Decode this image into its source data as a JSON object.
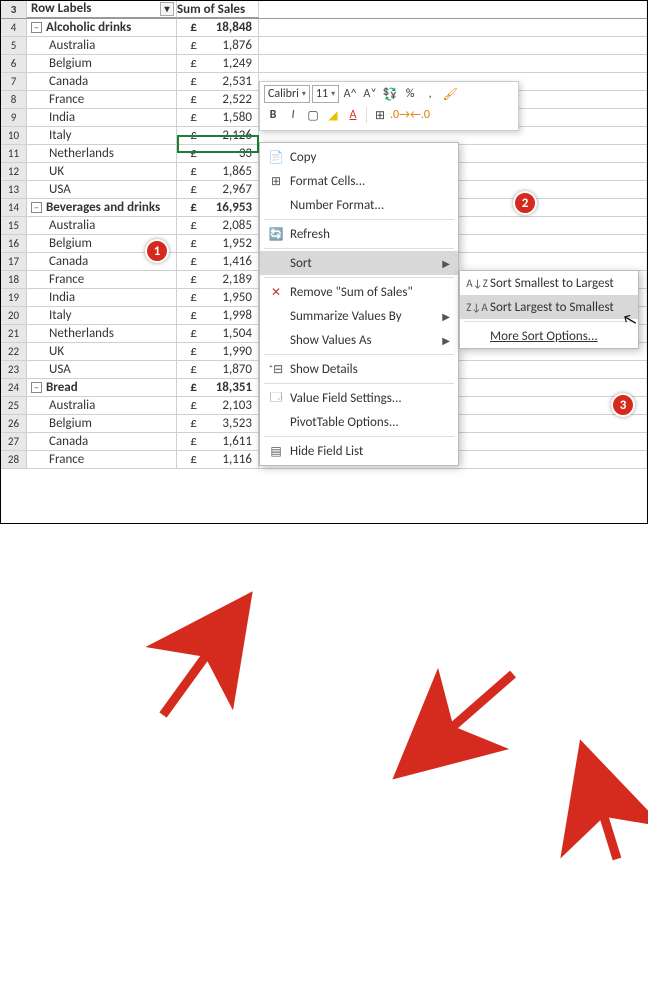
{
  "header": {
    "col_a": "Row Labels",
    "col_bc": "Sum of Sales"
  },
  "currency": "£",
  "rows": [
    {
      "n": 3,
      "type": "header"
    },
    {
      "n": 4,
      "type": "group",
      "label": "Alcoholic drinks",
      "value": "18,848"
    },
    {
      "n": 5,
      "type": "item",
      "label": "Australia",
      "value": "1,876"
    },
    {
      "n": 6,
      "type": "item",
      "label": "Belgium",
      "value": "1,249"
    },
    {
      "n": 7,
      "type": "item",
      "label": "Canada",
      "value": "2,531"
    },
    {
      "n": 8,
      "type": "item",
      "label": "France",
      "value": "2,522"
    },
    {
      "n": 9,
      "type": "item",
      "label": "India",
      "value": "1,580"
    },
    {
      "n": 10,
      "type": "item",
      "label": "Italy",
      "value": "2,126",
      "selected": true
    },
    {
      "n": 11,
      "type": "item",
      "label": "Netherlands",
      "value": "33",
      "obscured": true
    },
    {
      "n": 12,
      "type": "item",
      "label": "UK",
      "value": "1,865",
      "obscured": true
    },
    {
      "n": 13,
      "type": "item",
      "label": "USA",
      "value": "2,967"
    },
    {
      "n": 14,
      "type": "group",
      "label": "Beverages and drinks",
      "value": "16,953"
    },
    {
      "n": 15,
      "type": "item",
      "label": "Australia",
      "value": "2,085"
    },
    {
      "n": 16,
      "type": "item",
      "label": "Belgium",
      "value": "1,952"
    },
    {
      "n": 17,
      "type": "item",
      "label": "Canada",
      "value": "1,416"
    },
    {
      "n": 18,
      "type": "item",
      "label": "France",
      "value": "2,189"
    },
    {
      "n": 19,
      "type": "item",
      "label": "India",
      "value": "1,950"
    },
    {
      "n": 20,
      "type": "item",
      "label": "Italy",
      "value": "1,998"
    },
    {
      "n": 21,
      "type": "item",
      "label": "Netherlands",
      "value": "1,504"
    },
    {
      "n": 22,
      "type": "item",
      "label": "UK",
      "value": "1,990"
    },
    {
      "n": 23,
      "type": "item",
      "label": "USA",
      "value": "1,870"
    },
    {
      "n": 24,
      "type": "group",
      "label": "Bread",
      "value": "18,351"
    },
    {
      "n": 25,
      "type": "item",
      "label": "Australia",
      "value": "2,103"
    },
    {
      "n": 26,
      "type": "item",
      "label": "Belgium",
      "value": "3,523"
    },
    {
      "n": 27,
      "type": "item",
      "label": "Canada",
      "value": "1,611"
    },
    {
      "n": 28,
      "type": "item",
      "label": "France",
      "value": "1,116"
    }
  ],
  "mini_toolbar": {
    "font_name": "Calibri",
    "font_size": "11"
  },
  "ctx": {
    "copy": "Copy",
    "format_cells": "Format Cells...",
    "number_format": "Number Format...",
    "refresh": "Refresh",
    "sort": "Sort",
    "remove": "Remove \"Sum of Sales\"",
    "summarize": "Summarize Values By",
    "show_as": "Show Values As",
    "show_details": "Show Details",
    "value_settings": "Value Field Settings...",
    "pivot_options": "PivotTable Options...",
    "hide_field": "Hide Field List"
  },
  "sort_menu": {
    "asc": "Sort Smallest to Largest",
    "desc": "Sort Largest to Smallest",
    "more": "More Sort Options..."
  },
  "badges": {
    "b1": "1",
    "b2": "2",
    "b3": "3"
  }
}
